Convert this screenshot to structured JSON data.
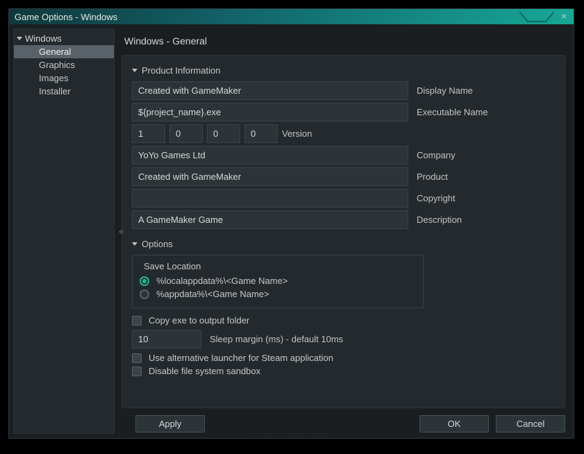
{
  "window": {
    "title": "Game Options - Windows"
  },
  "sidebar": {
    "root": "Windows",
    "items": [
      {
        "label": "General",
        "active": true
      },
      {
        "label": "Graphics",
        "active": false
      },
      {
        "label": "Images",
        "active": false
      },
      {
        "label": "Installer",
        "active": false
      }
    ]
  },
  "collapse_glyph": "«",
  "page_title": "Windows - General",
  "sections": {
    "product_info": {
      "header": "Product Information",
      "display_name": {
        "value": "Created with GameMaker",
        "label": "Display Name"
      },
      "executable_name": {
        "value": "${project_name}.exe",
        "label": "Executable Name"
      },
      "version": {
        "values": [
          "1",
          "0",
          "0",
          "0"
        ],
        "label": "Version"
      },
      "company": {
        "value": "YoYo Games Ltd",
        "label": "Company"
      },
      "product": {
        "value": "Created with GameMaker",
        "label": "Product"
      },
      "copyright": {
        "value": "",
        "label": "Copyright"
      },
      "description": {
        "value": "A GameMaker Game",
        "label": "Description"
      }
    },
    "options": {
      "header": "Options",
      "save_location": {
        "title": "Save Location",
        "choices": [
          {
            "label": "%localappdata%\\<Game Name>",
            "selected": true
          },
          {
            "label": "%appdata%\\<Game Name>",
            "selected": false
          }
        ]
      },
      "copy_exe": {
        "label": "Copy exe to output folder",
        "checked": false
      },
      "sleep_margin": {
        "value": "10",
        "label": "Sleep margin (ms) - default 10ms"
      },
      "alt_launcher": {
        "label": "Use alternative launcher for Steam application",
        "checked": false
      },
      "disable_sandbox": {
        "label": "Disable file system sandbox",
        "checked": false
      }
    }
  },
  "buttons": {
    "apply": "Apply",
    "ok": "OK",
    "cancel": "Cancel"
  }
}
